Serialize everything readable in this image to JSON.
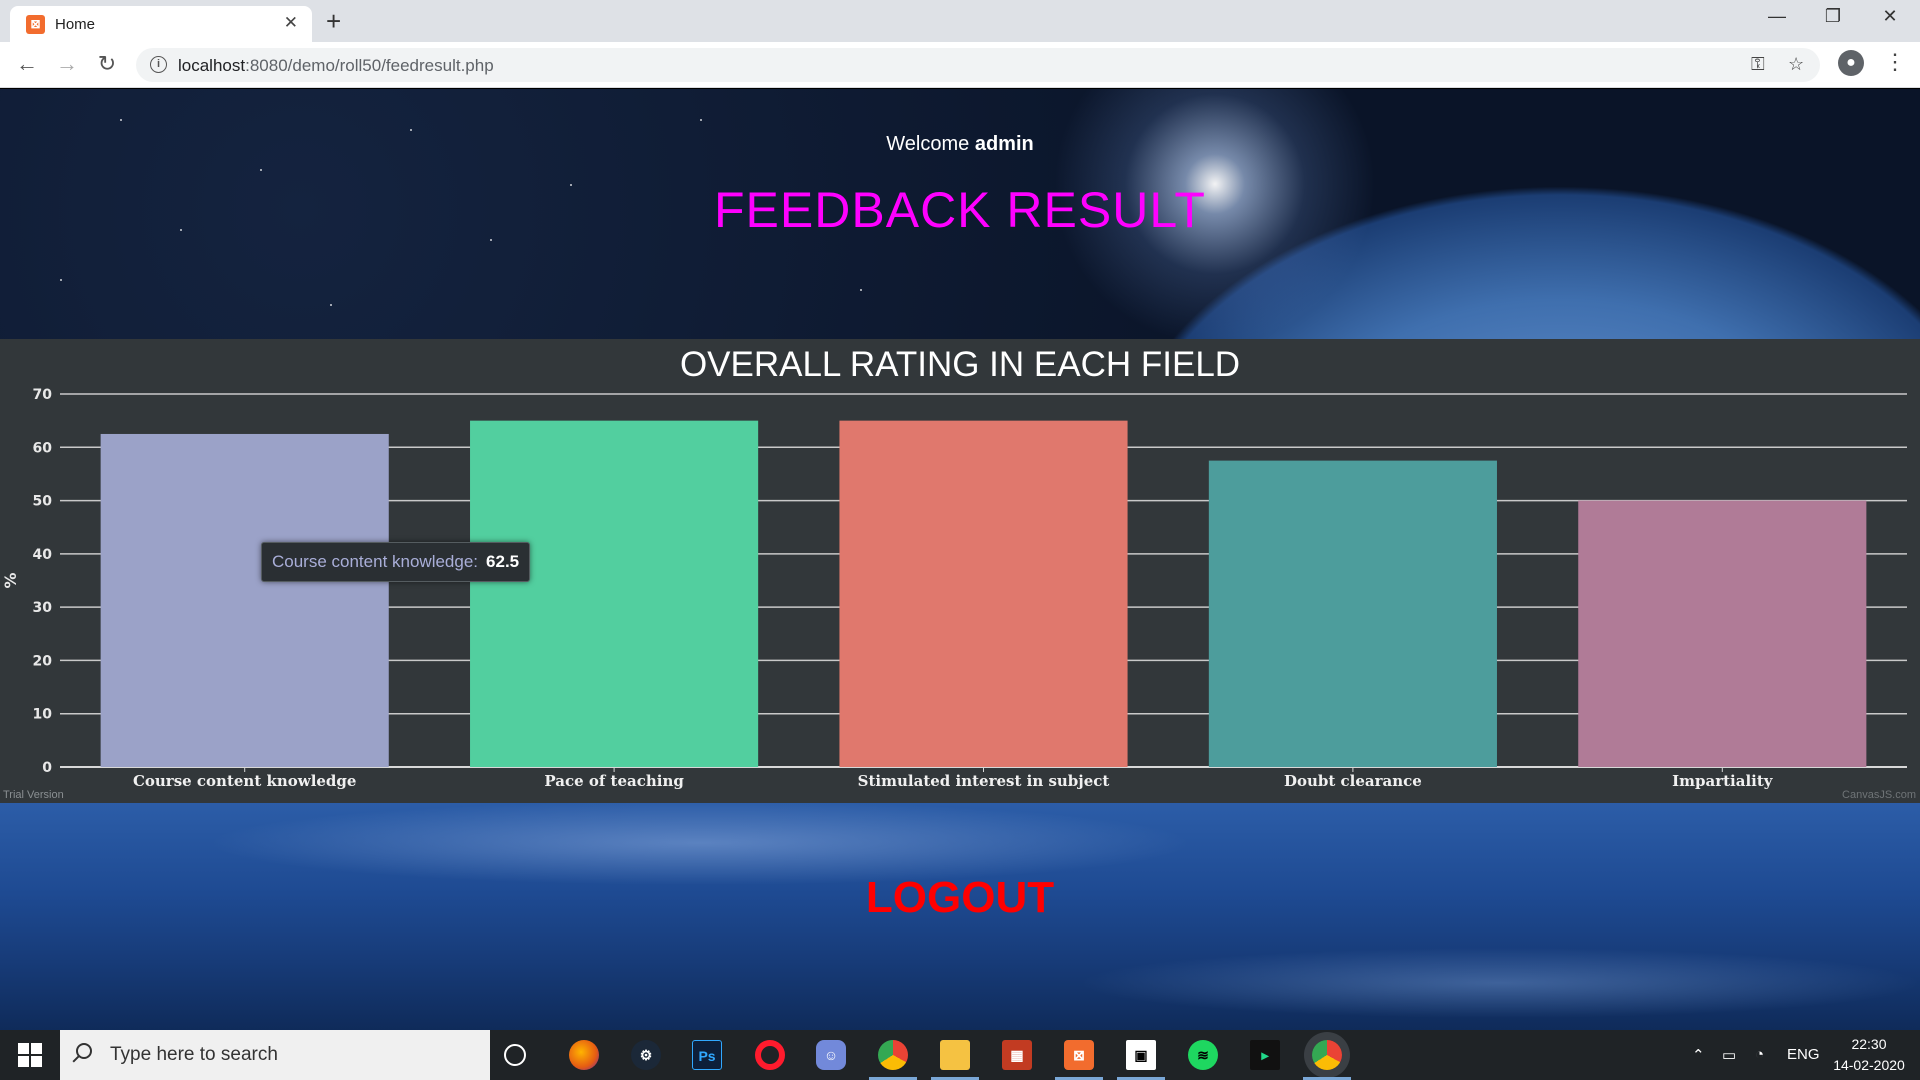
{
  "browser": {
    "tab_title": "Home",
    "tab_close": "✕",
    "new_tab": "+",
    "url_host": "localhost",
    "url_rest": ":8080/demo/roll50/feedresult.php",
    "window": {
      "minimize": "—",
      "restore": "❐",
      "close": "✕"
    },
    "nav": {
      "back": "←",
      "forward": "→",
      "reload": "↻"
    }
  },
  "header": {
    "welcome_prefix": "Welcome",
    "username": "admin",
    "title": "FEEDBACK RESULT"
  },
  "chart_data": {
    "type": "bar",
    "title": "OVERALL RATING IN EACH FIELD",
    "categories": [
      "Course content knowledge",
      "Pace of teaching",
      "Stimulated interest in subject",
      "Doubt clearance",
      "Impartiality"
    ],
    "values": [
      62.5,
      65,
      65,
      57.5,
      50
    ],
    "colors": [
      "#9ba2c8",
      "#52cf9f",
      "#e0786d",
      "#4d9d9c",
      "#b07b97"
    ],
    "ylabel": "%",
    "ylim": [
      0,
      70
    ],
    "yticks": [
      0,
      10,
      20,
      30,
      40,
      50,
      60,
      70
    ],
    "grid": true,
    "tooltip": {
      "label": "Course content knowledge:",
      "value": "62.5"
    },
    "watermark_left": "Trial Version",
    "watermark_right": "CanvasJS.com"
  },
  "footer": {
    "logout": "LOGOUT"
  },
  "taskbar": {
    "search_placeholder": "Type here to search",
    "language": "ENG",
    "time": "22:30",
    "date": "14-02-2020",
    "apps": [
      "cortana-icon",
      "firefox-icon",
      "steam-icon",
      "photoshop-icon",
      "opera-icon",
      "discord-icon",
      "chrome-icon",
      "file-explorer-icon",
      "app-icon",
      "xampp-icon",
      "intellij-icon",
      "spotify-icon",
      "pycharm-icon",
      "chrome-active-icon"
    ]
  }
}
